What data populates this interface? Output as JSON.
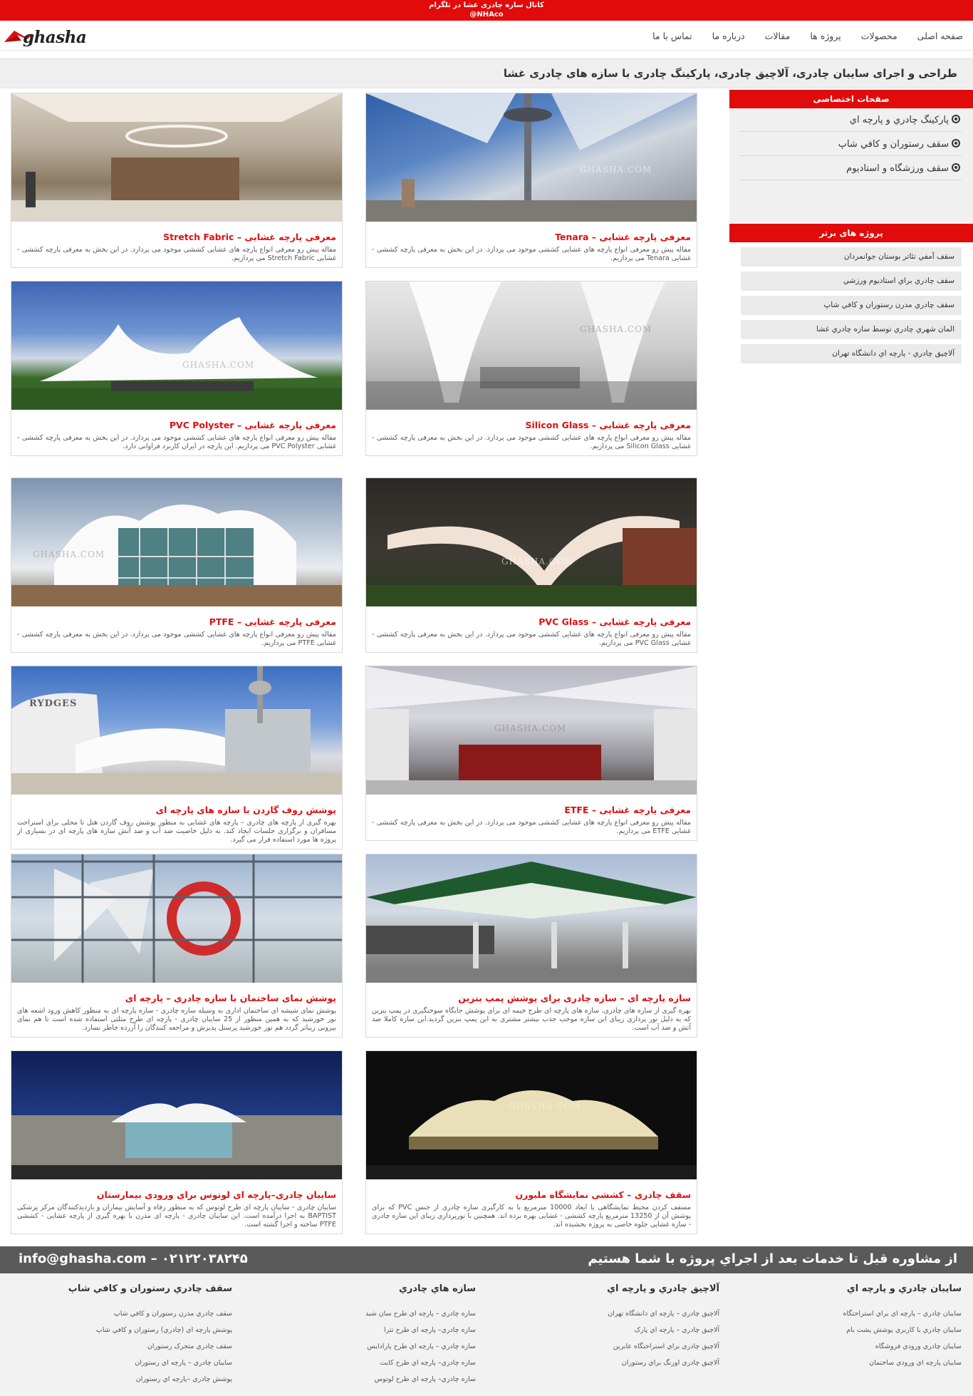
{
  "topbar": {
    "line1": "کانال سازه چادری غشا در تلگرام",
    "line2": "@NHAco"
  },
  "logo": {
    "text": "ghasha"
  },
  "nav": {
    "items": [
      "صفحه اصلی",
      "محصولات",
      "پروژه ها",
      "مقالات",
      "درباره ما",
      "تماس با ما"
    ]
  },
  "banner": {
    "title": "طراحی و اجرای سایبان چادری، آلاچیق چادری، پارکینگ چادری با سازه های چادری غشا"
  },
  "cards": [
    {
      "title": "معرفی پارچه غشایی – Tenara",
      "excerpt": "مقاله پیش رو معرفی انواع پارچه های غشایی کششی موجود می پردازد. در این بخش به معرفی پارچه کششی - غشایی Tenara می پردازیم.",
      "watermark": "GHASHA.COM"
    },
    {
      "title": "معرفی پارچه غشایی – Stretch Fabric",
      "excerpt": "مقاله پیش رو معرفی انواع پارچه های غشایی کششی موجود می پردازد. در این بخش به معرفی پارچه کششی - غشایی Stretch Fabric می پردازیم.",
      "watermark": ""
    },
    {
      "title": "معرفی پارچه غشایی – Silicon Glass",
      "excerpt": "مقاله پیش رو معرفی انواع پارچه های غشایی کششی موجود می پردازد. در این بخش به معرفی پارچه کششی - غشایی Silicon Glass می پردازیم.",
      "watermark": "GHASHA.COM"
    },
    {
      "title": "معرفی پارچه غشایی – PVC Polyster",
      "excerpt": "مقاله پیش رو معرفی انواع پارچه های غشایی کششی موجود می پردازد. در این بخش به معرفی پارچه کششی - غشایی PVC Polyster می پردازیم. این پارچه در ایران کاربرد فراوانی دارد.",
      "watermark": "GHASHA.COM"
    },
    {
      "title": "معرفی پارچه غشایی – PVC Glass",
      "excerpt": "مقاله پیش رو معرفی انواع پارچه های غشایی کششی موجود می پردازد. در این بخش به معرفی پارچه کششی - غشایی PVC Glass می پردازیم.",
      "watermark": "GHASHA.COM"
    },
    {
      "title": "معرفی پارچه غشایی – PTFE",
      "excerpt": "مقاله پیش رو معرفی انواع پارچه های غشایی کششی موجود می پردازد. در این بخش به معرفی پارچه کششی - غشایی PTFE می پردازیم.",
      "watermark": "GHASHA.COM"
    },
    {
      "title": "معرفی پارچه غشایی – ETFE",
      "excerpt": "مقاله پیش رو معرفی انواع پارچه های غشایی کششی موجود می پردازد. در این بخش به معرفی پارچه کششی - غشایی ETFE می پردازیم.",
      "watermark": "GHASHA.COM"
    },
    {
      "title": "پوشش روف گاردن با سازه های پارچه ای",
      "excerpt": "بهره گیری از پارچه های چادری – پارچه های غشایی به منظور پوشش روف گاردن هتل تا محلی برای استراحت مسافران و برگزاری جلسات ایجاد کند. به دلیل خاصیت ضد آب و ضد آتش سازه های پارچه ای در بسیاری از پروژه ها مورد استفاده قرار می گیرد.",
      "watermark": "RYDGES"
    },
    {
      "title": "سازه پارچه ای – سازه چادری برای پوشش پمپ بنزین",
      "excerpt": "بهره گیری از سازه های چادری، سازه های پارچه ای طرح خیمه ای برای پوشش جایگاه سوختگیری در پمپ بنزین که به دلیل نور پردازی زیبای این سازه موجب جذب بیشتر مشتری به این پمپ بنزین گردید.این سازه کاملا ضد آتش و ضد آب است.",
      "watermark": ""
    },
    {
      "title": "پوشش نمای ساختمان با سازه چادری – پارچه ای",
      "excerpt": "پوشش نمای شیشه ای ساختمان اداری به وسیله سازه چادری - سازه پارچه ای به منظور کاهش ورود اشعه های نور خورشید که به همین منظور از 25 سایبان چادری - پارچه ای طرح مثلثی استفاده شده است تا هم نمای بیرونی زیباتر گردد هم نور خورشید پرسنل پذیرش و مراجعه کنندگان را آزرده خاطر نسازد.",
      "watermark": ""
    },
    {
      "title": "سقف چادری – کششی نمایشگاه ملبورن",
      "excerpt": "مسقف کردن محیط نمایشگاهی با ابعاد 10000 مترمربع با به کارگیری سازه چادری از جنس PVC که برای پوشش آن از 13250 مترمربع پارچه کششی - غشایی بهره برده اند. همچنین با نورپردازی زیبای این سازه چادری - سازه غشایی جلوه خاصی به پروژه بخشیده اند.",
      "watermark": "GHASHA.COM"
    },
    {
      "title": "سایبان چادری–پارچه ای لوتوس برای ورودی بیمارستان",
      "excerpt": "سایبان چادری - سایبان پارچه ای طرح لوتوس که به منظور رفاه و آسایش بیماران و بازدیدکنندگان مرکز پزشکی BAPTIST به اجرا درآمده است. این سایبان چادری - پارچه ای مدرن با بهره گیری از پارچه غشایی - کششی PTFE ساخته و اجرا گشته است.",
      "watermark": ""
    }
  ],
  "sidebar": {
    "pages_title": "صفحات اختصاصی",
    "pages": [
      "پارکينگ چادري و پارچه اي",
      "سقف رستوران و کافي شاپ",
      "سقف ورزشگاه و استاديوم"
    ],
    "projects_title": "پروژه های برتر",
    "projects": [
      "سقف آمفي تئاتر بوستان جوانمردان",
      "سقف چادري براي استاديوم ورزشي",
      "سقف چادري مدرن رستوران و کافي شاپ",
      "المان شهري چادري توسط سازه چادري غشا",
      "آلاچيق چادري - پارچه اي دانشگاه تهران"
    ]
  },
  "cta": {
    "text": "از مشاوره قبل تا خدمات بعد از اجراي پروژه با شما هستيم",
    "contact": "info@ghasha.com – ۰۲۱۲۲۰۳۸۲۴۵"
  },
  "footer": {
    "columns": [
      {
        "title": "سايبان چادري و پارچه اي",
        "links": [
          "سايبان چادري – پارچه اي براي استراحتگاه",
          "سايبان چادري با کاربري پوشش پشت بام",
          "سايبان چادري ورودي فروشگاه",
          "سايبان پارچه اي ورودي ساختمان"
        ]
      },
      {
        "title": "آلاچيق چادري و پارچه اي",
        "links": [
          "آلاچيق چادري – پارچه اي دانشگاه تهران",
          "آلاچيق چادري – پارچه اي پارک",
          "آلاچيق چادري براي استراحتگاه عابرين",
          "آلاچيق چادري اورنگ براي رستوران"
        ]
      },
      {
        "title": "سازه هاي چادري",
        "links": [
          "سازه چادري – پارچه اي طرح سان شيد",
          "سازه چادري– پارچه اي طرح تترا",
          "سازه چادري – پارچه اي طرح پارادايس",
          "سازه چادري– پارچه اي طرح کايت",
          "سازه چادري– پارچه اي طرح لوتوس"
        ]
      },
      {
        "title": "سقف چادري رستوران و کافي شاپ",
        "links": [
          "سقف چادري مدرن رستوران و کافي شاپ",
          "پوشش پارچه اي (چادري) رستوران و کافي شاپ",
          "سقف چادري متحرک رستوران",
          "سايبان چادري – پارچه اي رستوران",
          "پوشش چادري –پارچه اي رستوران"
        ]
      }
    ]
  },
  "colors": {
    "accent": "#e10b0b",
    "link": "#3a6cc8",
    "cta": "#5a5a5a"
  }
}
